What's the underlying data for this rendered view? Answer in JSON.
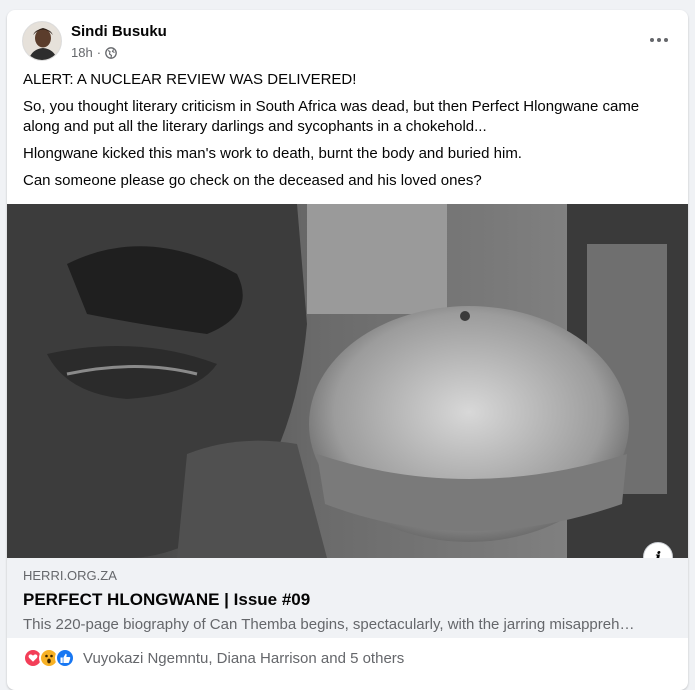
{
  "post": {
    "author": "Sindi Busuku",
    "time": "18h",
    "separator": "·",
    "privacy_icon": "globe-icon",
    "menu_icon": "more-options-icon",
    "paragraphs": [
      "ALERT: A NUCLEAR REVIEW WAS DELIVERED!",
      "So, you thought literary criticism in South Africa was dead, but then Perfect Hlongwane came along and put all the literary darlings and sycophants in a chokehold...",
      "Hlongwane kicked this man's work to death, burnt the body and buried him.",
      "Can someone please go check on the deceased and his loved ones?"
    ]
  },
  "link": {
    "domain": "HERRI.ORG.ZA",
    "title": "PERFECT HLONGWANE | Issue #09",
    "description": "This 220-page biography of Can Themba begins, spectacularly, with the jarring misappreh…",
    "info_label": "i"
  },
  "reactions": {
    "icons": [
      "love-icon",
      "wow-icon",
      "like-icon"
    ],
    "names": "Vuyokazi Ngemntu, Diana Harrison and 5 others"
  },
  "colors": {
    "love": "#f33e58",
    "wow": "#f7b125",
    "like": "#1877f2",
    "secondary_text": "#65676b",
    "preview_bg": "#f0f2f5"
  }
}
